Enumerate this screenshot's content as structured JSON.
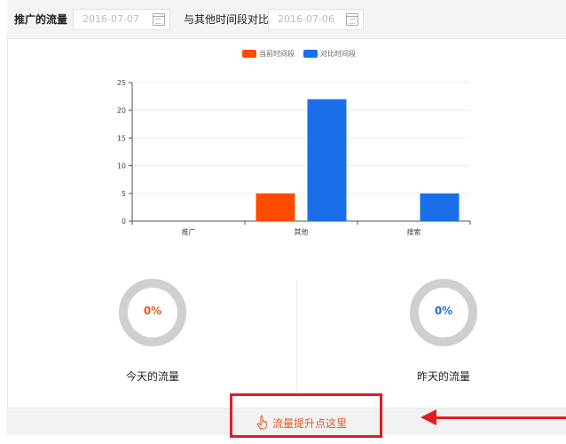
{
  "header": {
    "title": "推广的流量",
    "date_from": "2016-07-07",
    "compare_label": "与其他时间段对比",
    "date_compare": "2016-07-06"
  },
  "legend": {
    "current": {
      "label": "当前时间段",
      "color": "#ff4b00"
    },
    "compare": {
      "label": "对比时间段",
      "color": "#1a6fe8"
    }
  },
  "chart_data": {
    "type": "bar",
    "categories": [
      "推广",
      "其他",
      "搜索"
    ],
    "series": [
      {
        "name": "当前时间段",
        "values": [
          0,
          5,
          0
        ],
        "color": "#ff4b00"
      },
      {
        "name": "对比时间段",
        "values": [
          0,
          22,
          5
        ],
        "color": "#1a6fe8"
      }
    ],
    "yticks": [
      0,
      5,
      10,
      15,
      20,
      25
    ],
    "ylim": [
      0,
      25
    ],
    "grid": true,
    "legend_position": "top-center"
  },
  "stats": {
    "today": {
      "value": "0%",
      "label": "今天的流量",
      "color": "#e8581f"
    },
    "yesterday": {
      "value": "0%",
      "label": "昨天的流量",
      "color": "#1a6fe8"
    }
  },
  "footer": {
    "boost_label": "流量提升点这里",
    "icon": "hand-pointer-icon"
  },
  "annotation_color": "#e31c23"
}
